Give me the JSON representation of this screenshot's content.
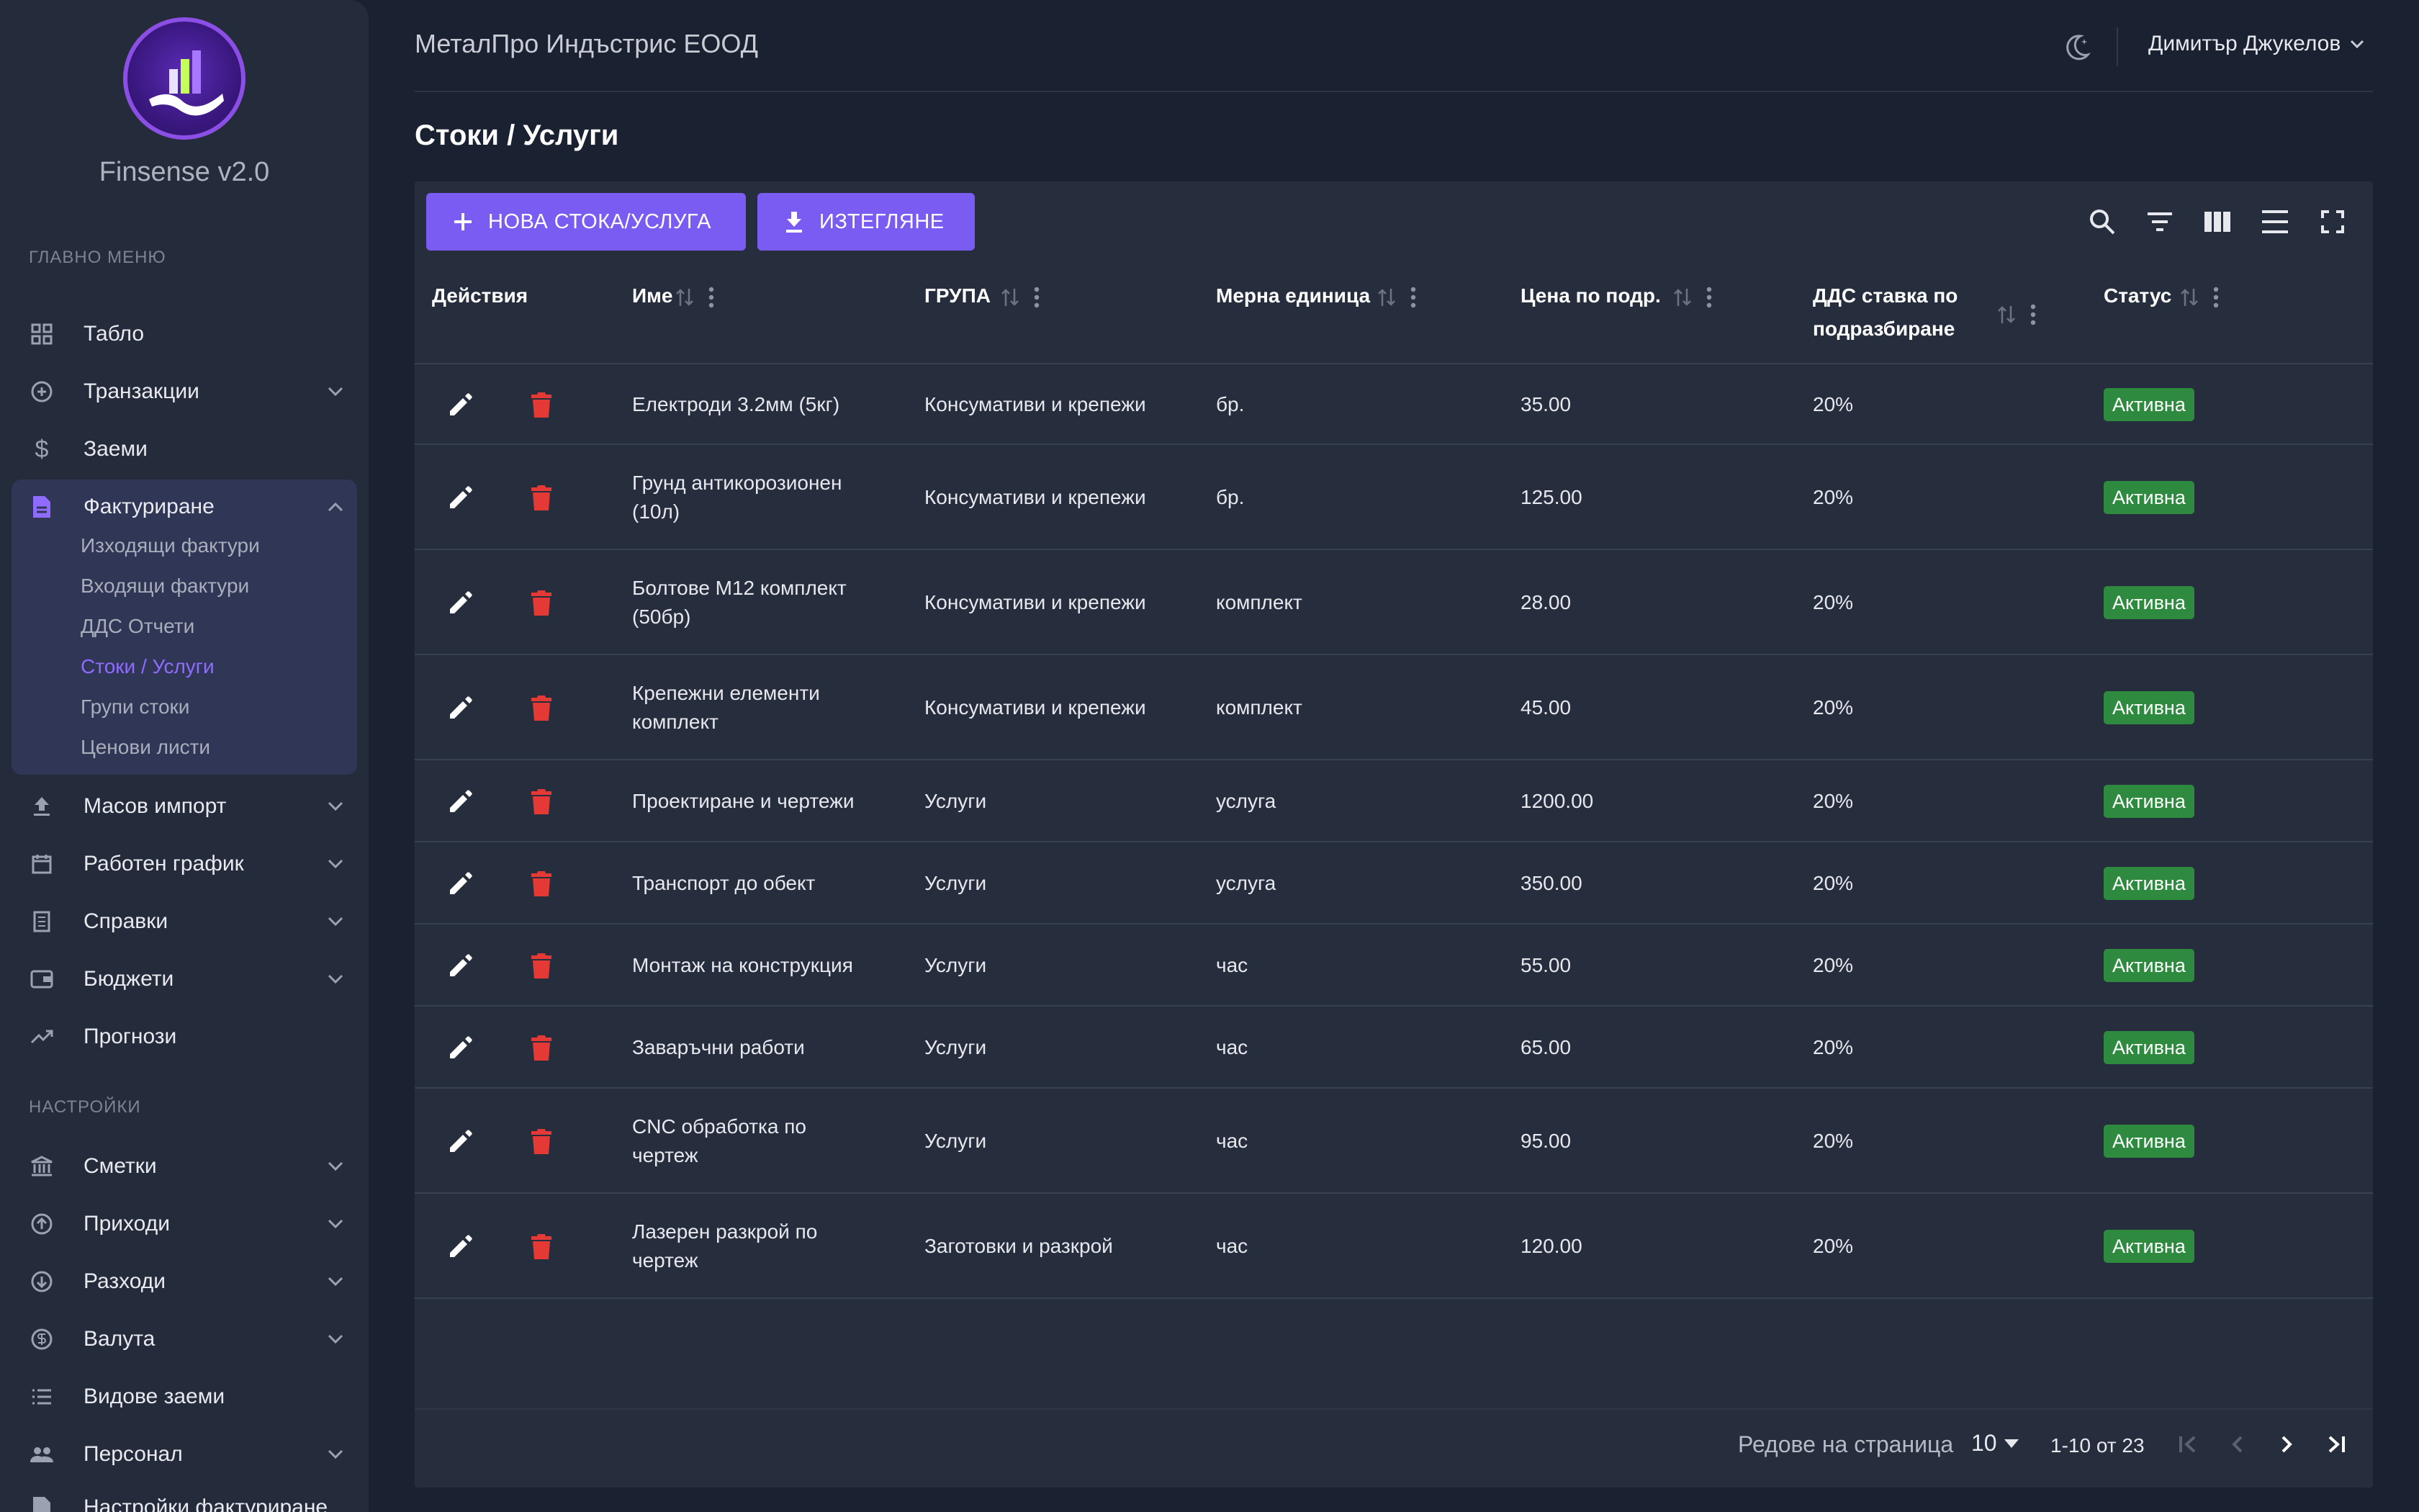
{
  "app": {
    "name": "Finsense v2.0"
  },
  "header": {
    "company": "МеталПро Индъстрис ЕООД",
    "user": "Димитър Джукелов"
  },
  "sidebar": {
    "main_section": "ГЛАВНО МЕНЮ",
    "settings_section": "НАСТРОЙКИ",
    "items": [
      {
        "label": "Табло"
      },
      {
        "label": "Транзакции"
      },
      {
        "label": "Заеми"
      },
      {
        "label": "Фактуриране"
      },
      {
        "label": "Масов импорт"
      },
      {
        "label": "Работен график"
      },
      {
        "label": "Справки"
      },
      {
        "label": "Бюджети"
      },
      {
        "label": "Прогнози"
      }
    ],
    "invoicing_sub": [
      {
        "label": "Изходящи фактури"
      },
      {
        "label": "Входящи фактури"
      },
      {
        "label": "ДДС Отчети"
      },
      {
        "label": "Стоки / Услуги"
      },
      {
        "label": "Групи стоки"
      },
      {
        "label": "Ценови листи"
      }
    ],
    "settings_items": [
      {
        "label": "Сметки"
      },
      {
        "label": "Приходи"
      },
      {
        "label": "Разходи"
      },
      {
        "label": "Валута"
      },
      {
        "label": "Видове заеми"
      },
      {
        "label": "Персонал"
      },
      {
        "label": "Настройки фактуриране"
      }
    ]
  },
  "page": {
    "title": "Стоки / Услуги"
  },
  "toolbar": {
    "new_label": "НОВА СТОКА/УСЛУГА",
    "export_label": "ИЗТЕГЛЯНЕ"
  },
  "table": {
    "columns": [
      "Действия",
      "Име",
      "ГРУПА",
      "Мерна единица",
      "Цена по подр.",
      "ДДС ставка по подразбиране",
      "Статус"
    ],
    "rows": [
      {
        "name": "Електроди 3.2мм (5кг)",
        "group": "Консумативи и крепежи",
        "unit": "бр.",
        "price": "35.00",
        "vat": "20%",
        "status": "Активна"
      },
      {
        "name": "Грунд антикорозионен (10л)",
        "group": "Консумативи и крепежи",
        "unit": "бр.",
        "price": "125.00",
        "vat": "20%",
        "status": "Активна"
      },
      {
        "name": "Болтове М12 комплект (50бр)",
        "group": "Консумативи и крепежи",
        "unit": "комплект",
        "price": "28.00",
        "vat": "20%",
        "status": "Активна"
      },
      {
        "name": "Крепежни елементи комплект",
        "group": "Консумативи и крепежи",
        "unit": "комплект",
        "price": "45.00",
        "vat": "20%",
        "status": "Активна"
      },
      {
        "name": "Проектиране и чертежи",
        "group": "Услуги",
        "unit": "услуга",
        "price": "1200.00",
        "vat": "20%",
        "status": "Активна"
      },
      {
        "name": "Транспорт до обект",
        "group": "Услуги",
        "unit": "услуга",
        "price": "350.00",
        "vat": "20%",
        "status": "Активна"
      },
      {
        "name": "Монтаж на конструкция",
        "group": "Услуги",
        "unit": "час",
        "price": "55.00",
        "vat": "20%",
        "status": "Активна"
      },
      {
        "name": "Заваръчни работи",
        "group": "Услуги",
        "unit": "час",
        "price": "65.00",
        "vat": "20%",
        "status": "Активна"
      },
      {
        "name": "CNC обработка по чертеж",
        "group": "Услуги",
        "unit": "час",
        "price": "95.00",
        "vat": "20%",
        "status": "Активна"
      },
      {
        "name": "Лазерен разкрой по чертеж",
        "group": "Заготовки и разкрой",
        "unit": "час",
        "price": "120.00",
        "vat": "20%",
        "status": "Активна"
      }
    ]
  },
  "pagination": {
    "rows_per_page_label": "Редове на страница",
    "rows_per_page": "10",
    "range": "1-10 от 23"
  },
  "colors": {
    "accent": "#7b5cf3",
    "status_active": "#2d8a3e",
    "delete": "#e53935",
    "background": "#1a2130"
  }
}
